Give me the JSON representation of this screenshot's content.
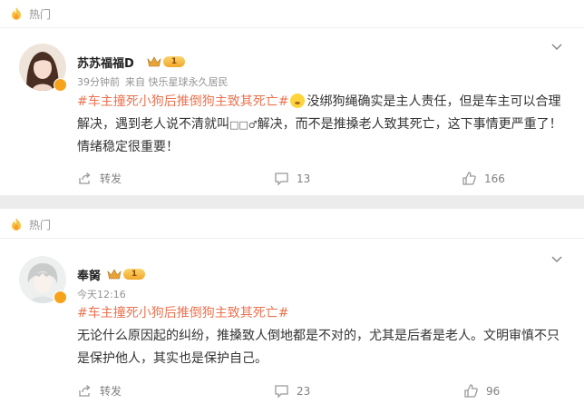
{
  "comments": [
    {
      "section_label": "热门",
      "username": "苏苏福福D",
      "vip_level": "1",
      "time": "39分钟前",
      "source": "来自 快乐星球永久居民",
      "topic": "#车主撞死小狗后推倒狗主致其死亡#",
      "text_after_emoji": "没绑狗绳确实是主人责任，但是车主可以合理解决，遇到老人说不清就叫",
      "text_end": "解决，而不是推搡老人致其死亡，这下事情更严重了！情绪稳定很重要！",
      "repost_label": "转发",
      "comment_count": "13",
      "like_count": "166"
    },
    {
      "section_label": "热门",
      "username": "奉胬",
      "vip_level": "1",
      "time": "今天12:16",
      "topic": "#车主撞死小狗后推倒狗主致其死亡#",
      "text": "无论什么原因起的纠纷，推搡致人倒地都是不对的，尤其是后者是老人。文明审慎不只是保护他人，其实也是保护自己。",
      "repost_label": "转发",
      "comment_count": "23",
      "like_count": "96"
    }
  ]
}
